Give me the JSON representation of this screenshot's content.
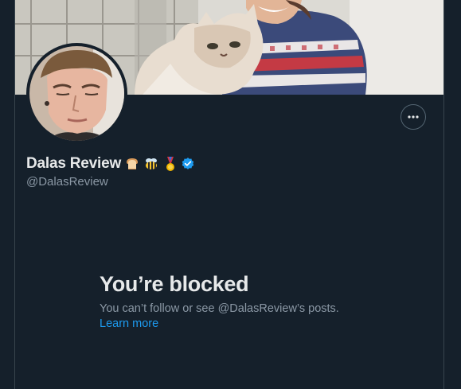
{
  "profile": {
    "display_name": "Dalas Review",
    "handle": "@DalasReview",
    "name_emojis": [
      "bread-emoji",
      "bee-emoji",
      "medal-emoji"
    ],
    "verified_icon": "verified-badge-icon"
  },
  "blocked": {
    "title": "You’re blocked",
    "message": "You can’t follow or see @DalasReview’s posts.",
    "link_label": "Learn more"
  },
  "icons": {
    "more": "more-options-icon"
  },
  "colors": {
    "background": "#15202b",
    "primary_text": "#e7e9ea",
    "secondary_text": "#8b98a5",
    "accent": "#1d9bf0",
    "border": "#38444d"
  }
}
